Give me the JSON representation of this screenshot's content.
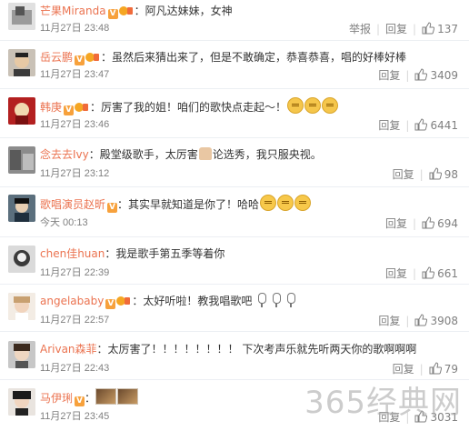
{
  "comments": [
    {
      "username": "芒果Miranda",
      "text": "：阿凡达妹妹，女神",
      "time": "11月27日 23:48",
      "report": "举报",
      "reply": "回复",
      "likes": "137"
    },
    {
      "username": "岳云鹏",
      "text": "：虽然后来猜出来了，但是不敢确定，恭喜恭喜，唱的好棒好棒",
      "time": "11月27日 23:47",
      "reply": "回复",
      "likes": "3409"
    },
    {
      "username": "韩庚",
      "text": "：厉害了我的姐！咱们的歌快点走起～！",
      "time": "11月27日 23:46",
      "reply": "回复",
      "likes": "6441"
    },
    {
      "username": "念去去Ivy",
      "text_a": "：殿堂级歌手，太厉害",
      "text_b": "论选秀，我只服央视。",
      "time": "11月27日 23:12",
      "reply": "回复",
      "likes": "98"
    },
    {
      "username": "歌唱演员赵昕",
      "text": "：其实早就知道是你了！哈哈",
      "time": "今天 00:13",
      "reply": "回复",
      "likes": "694"
    },
    {
      "username": "chen佳huan",
      "text": "：我是歌手第五季等着你",
      "time": "11月27日 22:39",
      "reply": "回复",
      "likes": "661"
    },
    {
      "username": "angelababy",
      "text": "：太好听啦！教我唱歌吧",
      "time": "11月27日 22:57",
      "reply": "回复",
      "likes": "3908"
    },
    {
      "username": "Arivan森菲",
      "text": "：太厉害了！！！！！！！！  下次考声乐就先听两天你的歌啊啊啊",
      "time": "11月27日 22:43",
      "reply": "回复",
      "likes": "79"
    },
    {
      "username": "马伊琍",
      "text": "：",
      "time": "11月27日 23:45",
      "reply": "回复",
      "likes": "3031"
    }
  ],
  "badge_letter": "V",
  "watermark": "365经典网",
  "colors": {
    "username": "#eb7350",
    "meta": "#808080",
    "text": "#333333"
  }
}
